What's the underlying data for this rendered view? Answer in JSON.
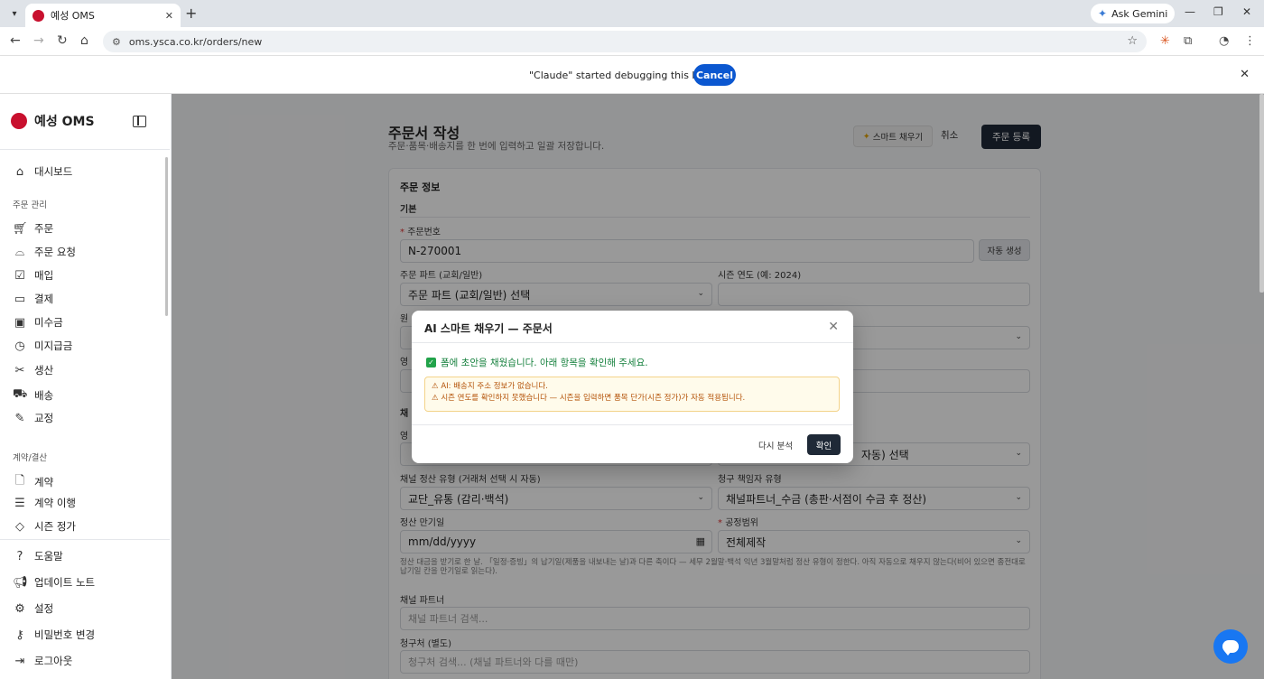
{
  "browser": {
    "tab_title": "예성 OMS",
    "tab_close": "✕",
    "new_tab": "+",
    "gemini_label": "Ask Gemini",
    "url": "oms.ysca.co.kr/orders/new",
    "infobar_message": "\"Claude\" started debugging this browser",
    "infobar_cancel": "Cancel"
  },
  "sidebar": {
    "brand": "예성 OMS",
    "items_top": [
      {
        "label": "대시보드",
        "icon": "home-icon"
      }
    ],
    "section_orders": "주문 관리",
    "items_orders": [
      {
        "label": "주문",
        "icon": "cart-icon"
      },
      {
        "label": "주문 요청",
        "icon": "inbox-icon"
      },
      {
        "label": "매입",
        "icon": "clipboard-check-icon"
      },
      {
        "label": "결제",
        "icon": "credit-card-icon"
      },
      {
        "label": "미수금",
        "icon": "banknote-icon"
      },
      {
        "label": "미지급금",
        "icon": "receipt-icon"
      },
      {
        "label": "생산",
        "icon": "scissors-icon"
      },
      {
        "label": "배송",
        "icon": "truck-icon"
      },
      {
        "label": "교정",
        "icon": "edit-icon"
      }
    ],
    "section_contract": "계약/결산",
    "items_contract": [
      {
        "label": "계약",
        "icon": "document-icon"
      },
      {
        "label": "계약 이행",
        "icon": "list-document-icon"
      },
      {
        "label": "시즌 정가",
        "icon": "tag-icon"
      }
    ],
    "items_bottom": [
      {
        "label": "도움말",
        "icon": "help-icon"
      },
      {
        "label": "업데이트 노트",
        "icon": "megaphone-icon"
      },
      {
        "label": "설정",
        "icon": "gear-icon"
      },
      {
        "label": "비밀번호 변경",
        "icon": "key-icon"
      },
      {
        "label": "로그아웃",
        "icon": "logout-icon"
      }
    ]
  },
  "page": {
    "title": "주문서 작성",
    "subtitle": "주문·품목·배송지를 한 번에 입력하고 일괄 저장합니다.",
    "smart_fill_button": "스마트 채우기",
    "cancel_button": "취소",
    "submit_button": "주문 등록"
  },
  "form": {
    "card_title": "주문 정보",
    "section_basic": "기본",
    "order_number_label": "주문번호",
    "order_number_value": "N-270001",
    "auto_generate_button": "자동 생성",
    "order_part_label": "주문 파트 (교회/일반)",
    "order_part_value": "주문 파트 (교회/일반) 선택",
    "season_year_label": "시즌 연도 (예: 2024)",
    "season_year_value": "",
    "row3_label_partial": "원",
    "row4_label_partial": "영",
    "section_channel_partial": "채",
    "row5_label_partial": "영",
    "channel_type_value_partial": "자동) 선택",
    "channel_settlement_label": "채널 정산 유형 (거래처 선택 시 자동)",
    "channel_settlement_value": "교단_유통 (감리·백석)",
    "billing_owner_label": "청구 책임자 유형",
    "billing_owner_value": "채널파트너_수금 (총판·서점이 수금 후 정산)",
    "settlement_due_label": "정산 만기일",
    "settlement_due_value": "mm/dd/yyyy",
    "process_scope_label": "공정범위",
    "process_scope_value": "전체제작",
    "settlement_help": "정산 대금을 받기로 한 날. 「일정·증빙」의 납기일(제품을 내보내는 날)과 다른 축이다 — 세무 2월말·백석 익년 3월말처럼 정산 유형이 정한다. 아직 자동으로 채우지 않는다(비어 있으면 종전대로 납기일 칸을 만기일로 읽는다).",
    "channel_partner_label": "채널 파트너",
    "channel_partner_placeholder": "채널 파트너 검색...",
    "billing_target_label": "청구처 (별도)",
    "billing_target_placeholder": "청구처 검색... (채널 파트너와 다를 때만)"
  },
  "modal": {
    "title": "AI 스마트 채우기 — 주문서",
    "success_message": "폼에 초안을 채웠습니다. 아래 항목을 확인해 주세요.",
    "warnings": [
      "⚠ AI: 배송지 주소 정보가 없습니다.",
      "⚠ 시즌 연도를 확인하지 못했습니다 — 시즌을 입력하면 품목 단가(시즌 정가)가 자동 적용됩니다."
    ],
    "reanalyze_button": "다시 분석",
    "confirm_button": "확인"
  },
  "colors": {
    "brand_red": "#c8102e",
    "primary_dark": "#1f2937",
    "chrome_blue": "#0b57d0",
    "success_green": "#15803d",
    "warning_amber": "#b45309",
    "chat_blue": "#1877f2"
  }
}
